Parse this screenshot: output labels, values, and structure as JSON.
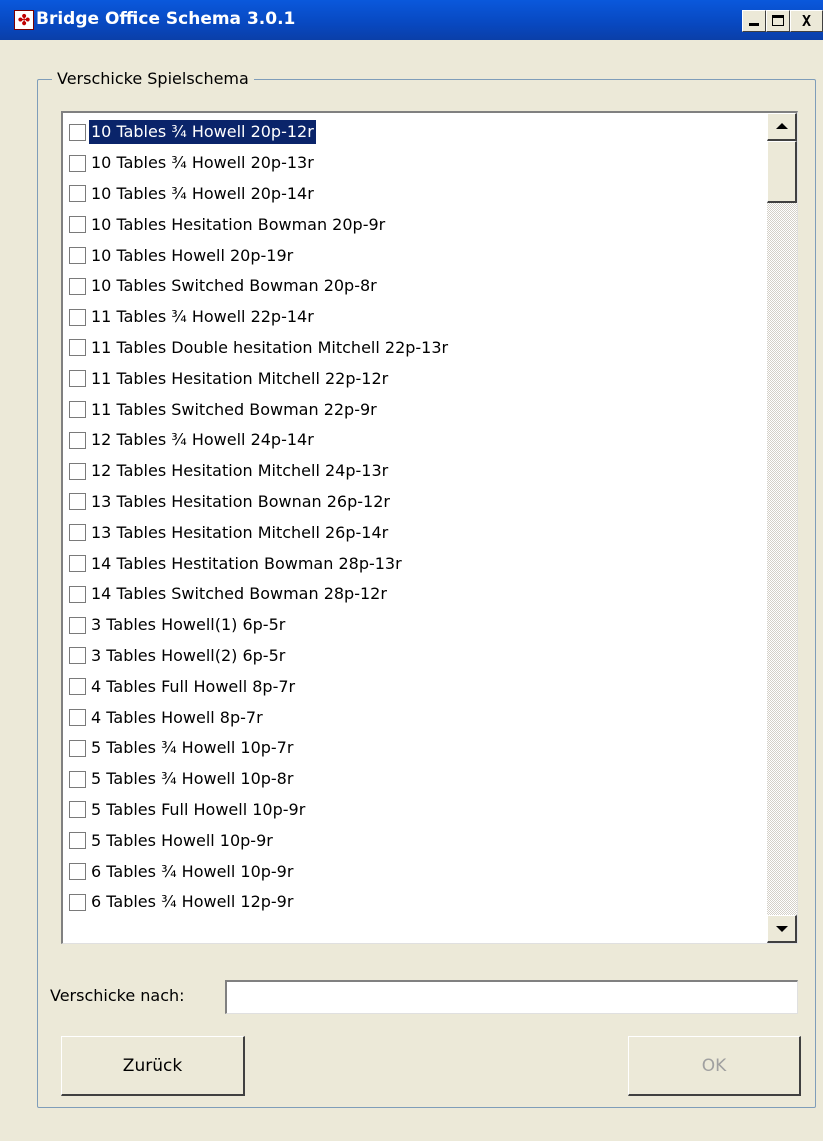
{
  "window": {
    "title": "Bridge Office Schema 3.0.1",
    "icon": "bridge-app-icon",
    "controls": {
      "minimize": "minimize-icon",
      "maximize": "maximize-icon",
      "close": "X"
    }
  },
  "group": {
    "legend": "Verschicke Spielschema"
  },
  "schema_list": {
    "selected_index": 0,
    "items": [
      {
        "label": "10 Tables ¾ Howell 20p-12r",
        "checked": false
      },
      {
        "label": "10 Tables ¾ Howell 20p-13r",
        "checked": false
      },
      {
        "label": "10 Tables ¾ Howell 20p-14r",
        "checked": false
      },
      {
        "label": "10 Tables Hesitation Bowman 20p-9r",
        "checked": false
      },
      {
        "label": "10 Tables Howell 20p-19r",
        "checked": false
      },
      {
        "label": "10 Tables Switched Bowman 20p-8r",
        "checked": false
      },
      {
        "label": "11 Tables ¾ Howell 22p-14r",
        "checked": false
      },
      {
        "label": "11 Tables Double hesitation Mitchell 22p-13r",
        "checked": false
      },
      {
        "label": "11 Tables Hesitation Mitchell 22p-12r",
        "checked": false
      },
      {
        "label": "11 Tables Switched Bowman 22p-9r",
        "checked": false
      },
      {
        "label": "12 Tables ¾ Howell 24p-14r",
        "checked": false
      },
      {
        "label": "12 Tables Hesitation Mitchell 24p-13r",
        "checked": false
      },
      {
        "label": "13 Tables Hesitation Bownan 26p-12r",
        "checked": false
      },
      {
        "label": "13 Tables Hesitation Mitchell 26p-14r",
        "checked": false
      },
      {
        "label": "14 Tables Hestitation Bowman 28p-13r",
        "checked": false
      },
      {
        "label": "14 Tables Switched Bowman 28p-12r",
        "checked": false
      },
      {
        "label": "3 Tables Howell(1) 6p-5r",
        "checked": false
      },
      {
        "label": "3 Tables Howell(2)  6p-5r",
        "checked": false
      },
      {
        "label": "4 Tables Full Howell 8p-7r",
        "checked": false
      },
      {
        "label": "4 Tables Howell 8p-7r",
        "checked": false
      },
      {
        "label": "5 Tables ¾ Howell 10p-7r",
        "checked": false
      },
      {
        "label": "5 Tables ¾ Howell 10p-8r",
        "checked": false
      },
      {
        "label": "5 Tables Full Howell 10p-9r",
        "checked": false
      },
      {
        "label": "5 Tables Howell 10p-9r",
        "checked": false
      },
      {
        "label": "6 Tables ¾ Howell 10p-9r",
        "checked": false
      },
      {
        "label": "6 Tables ¾ Howell 12p-9r",
        "checked": false
      }
    ]
  },
  "destination": {
    "label": "Verschicke nach:",
    "value": "",
    "placeholder": ""
  },
  "buttons": {
    "back": "Zurück",
    "ok": "OK",
    "ok_enabled": false
  },
  "colors": {
    "titlebar": "#0a4fd0",
    "selection": "#0a246a",
    "dialog_bg": "#ece9d8",
    "disabled_text": "#a0a0a0"
  }
}
